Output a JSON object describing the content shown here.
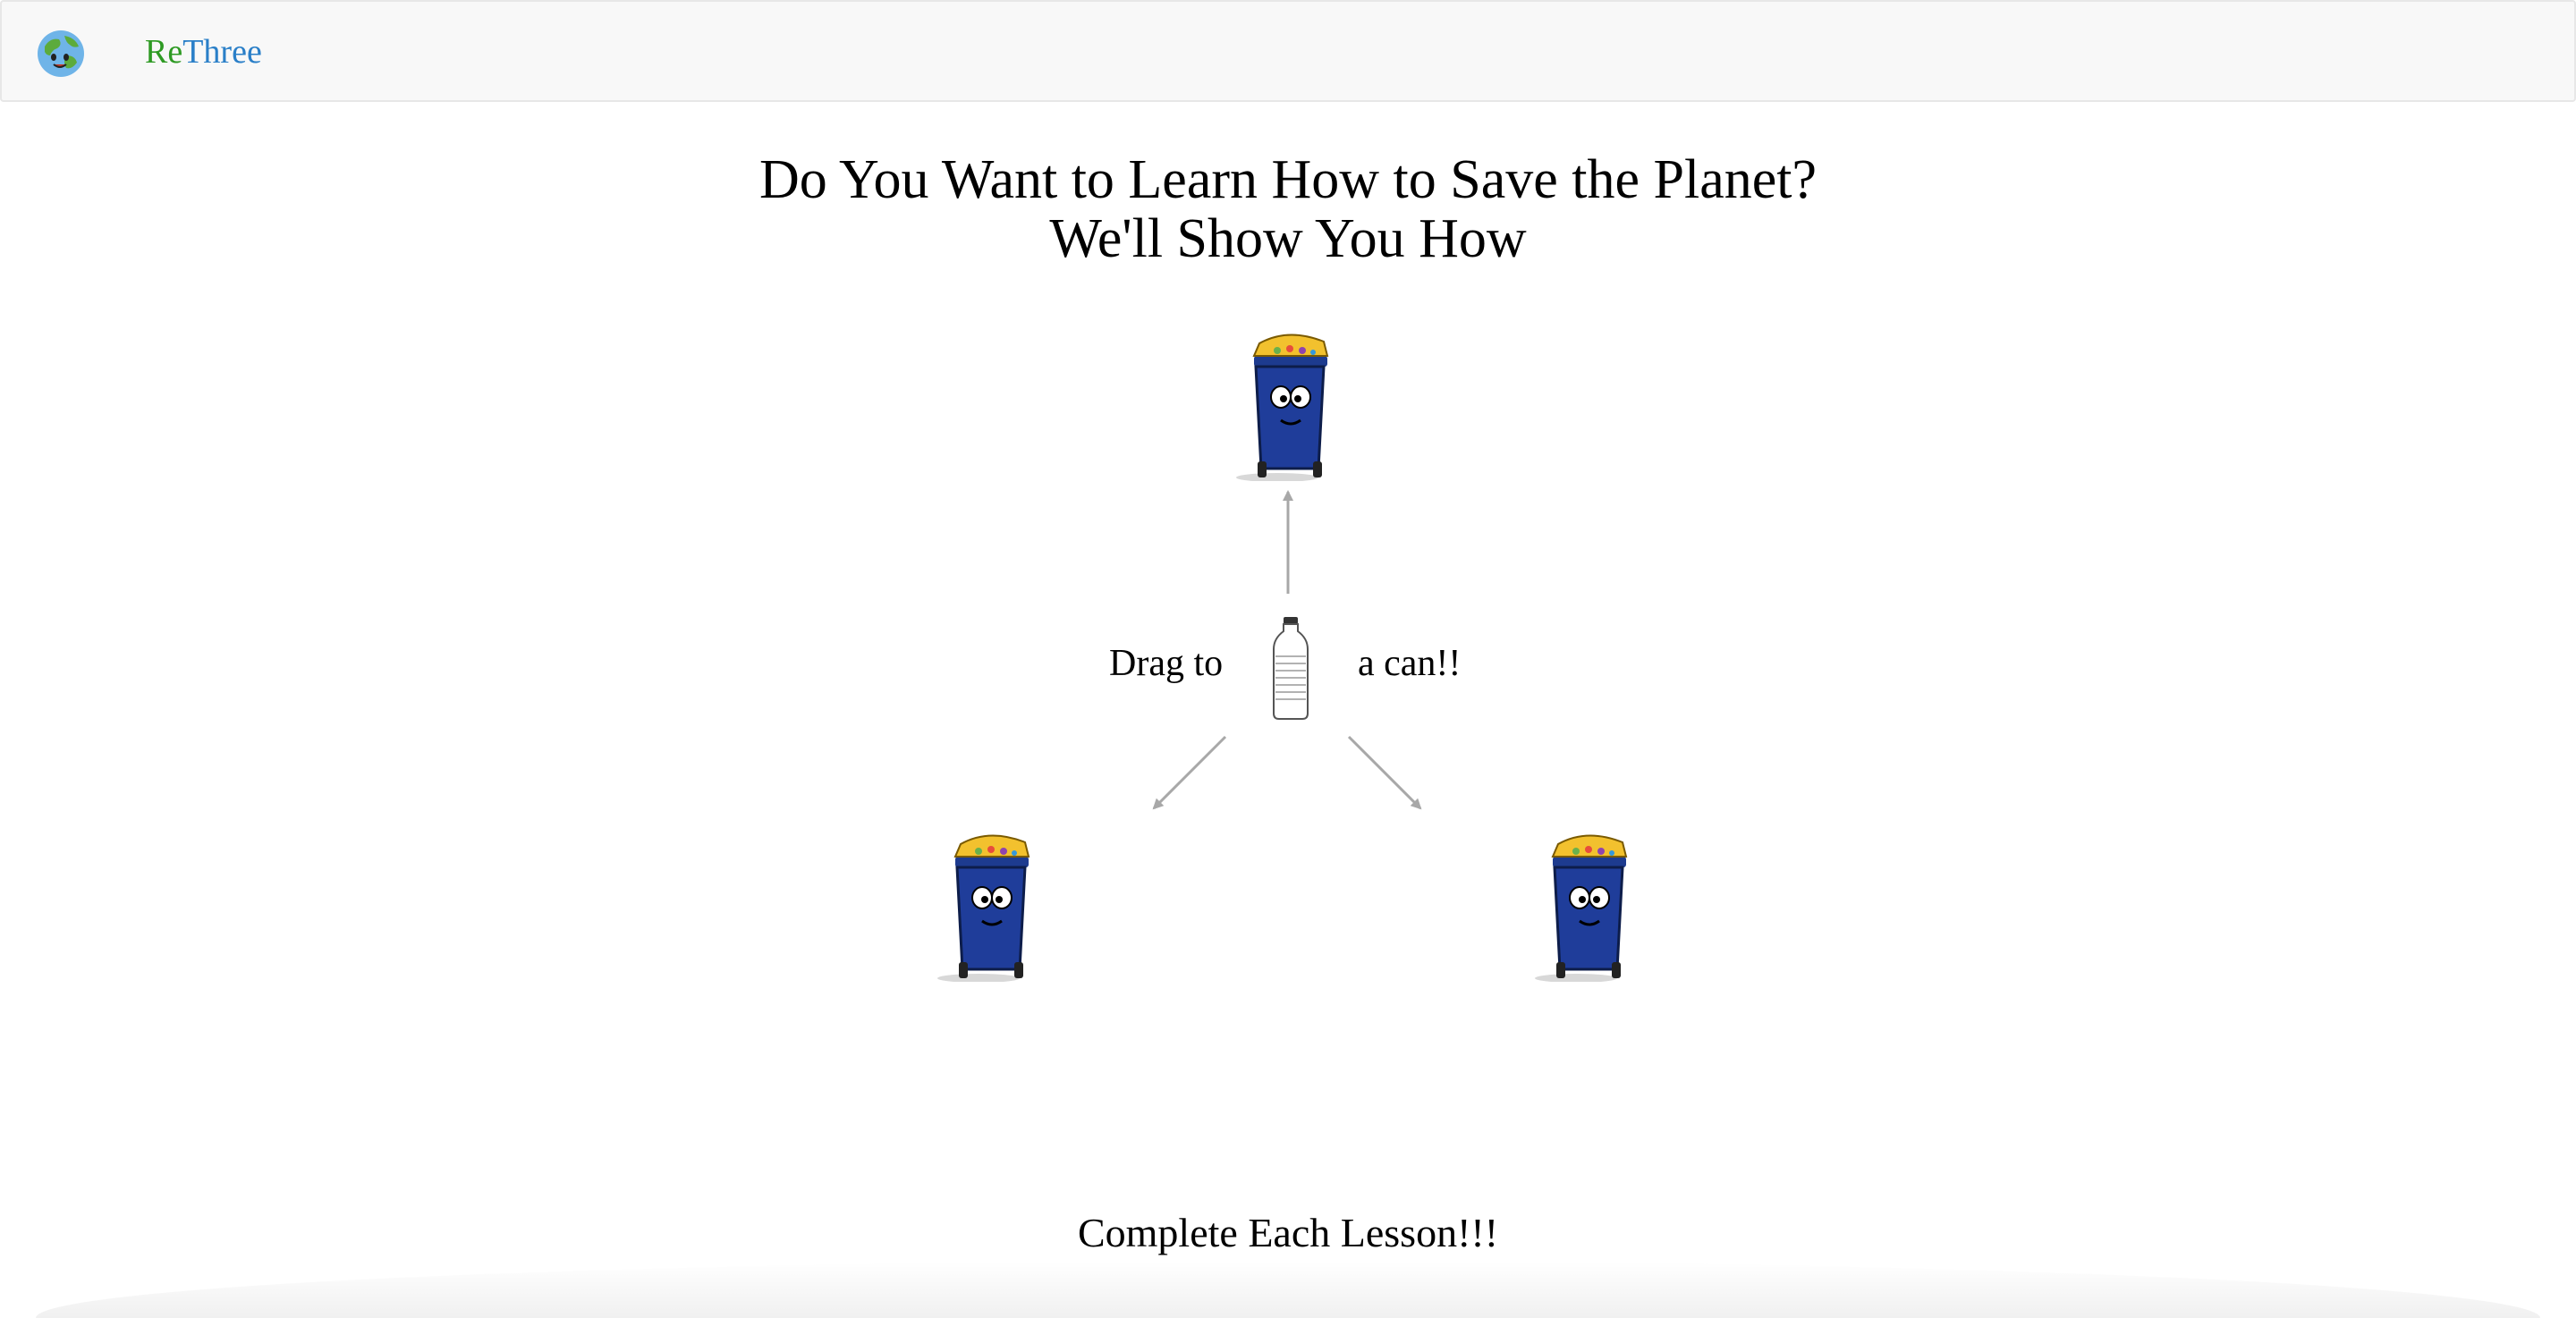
{
  "navbar": {
    "logo_icon": "earth-globe-icon",
    "brand_part1": "Re",
    "brand_part2": "Three",
    "brand_colors": {
      "re": "#2e9a23",
      "three": "#2a7fc8"
    }
  },
  "hero": {
    "title_line1": "Do You Want to Learn How to Save the Planet?",
    "title_line2": "We'll Show You How"
  },
  "game": {
    "instruction_left": "Drag to",
    "instruction_right": "a can!!",
    "draggable_item_icon": "water-bottle-icon",
    "bin_icon": "recycling-bin-character-icon",
    "bin_color": "#1f3d9a",
    "lid_color": "#f2c12e"
  },
  "footer": {
    "text": "Complete Each Lesson!!!"
  }
}
